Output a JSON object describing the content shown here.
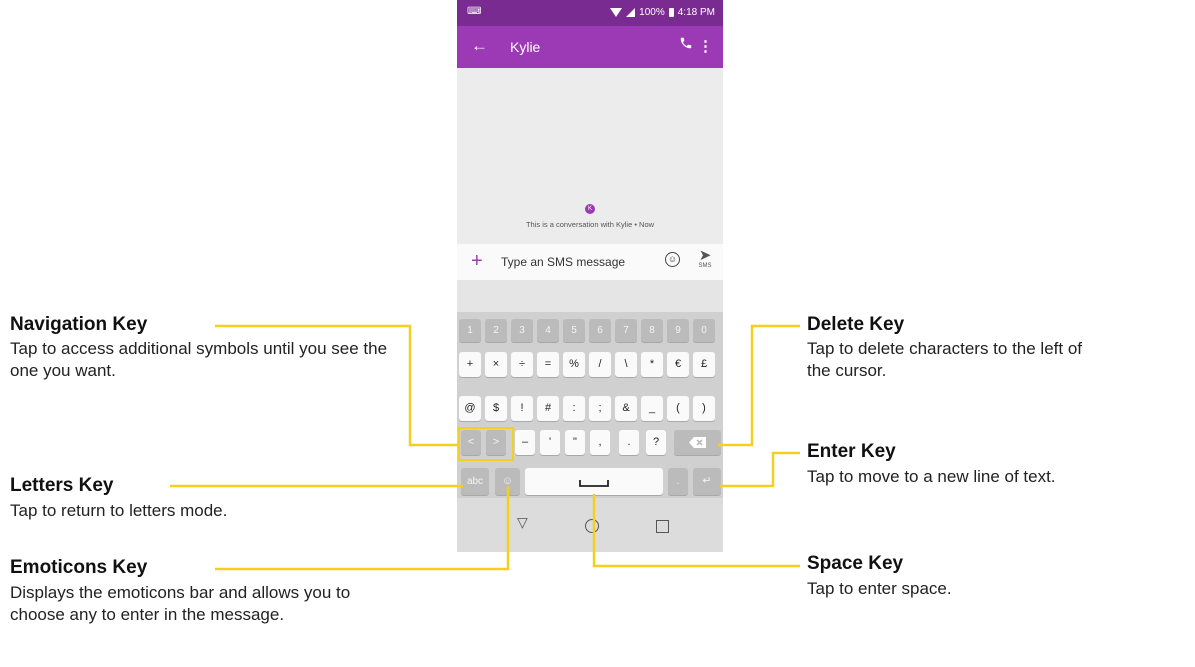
{
  "phone": {
    "status_bar": {
      "time": "4:18 PM",
      "battery": "100%"
    },
    "app_bar": {
      "back_icon": "arrow-left-icon",
      "title": "Kylie",
      "call_icon": "phone-icon",
      "more_icon": "more-vert-icon"
    },
    "conversation": {
      "avatar_letter": "K",
      "info": "This is a conversation with Kylie • Now"
    },
    "composer": {
      "placeholder": "Type an SMS message",
      "send_label": "SMS"
    },
    "keyboard": {
      "row1": [
        "1",
        "2",
        "3",
        "4",
        "5",
        "6",
        "7",
        "8",
        "9",
        "0"
      ],
      "row2": [
        "+",
        "×",
        "÷",
        "=",
        "%",
        "/",
        "\\",
        "*",
        "€",
        "£"
      ],
      "row3": [
        "@",
        "$",
        "!",
        "#",
        ":",
        ";",
        "&",
        "_",
        "(",
        ")"
      ],
      "row4": [
        "<",
        ">",
        "–",
        "'",
        "\"",
        ",",
        ".",
        "?"
      ],
      "abc_label": "abc",
      "period_label": "."
    }
  },
  "callouts": {
    "navigation": {
      "title": "Navigation Key",
      "desc": "Tap to access additional symbols until you see the one you want."
    },
    "letters": {
      "title": "Letters Key",
      "desc": "Tap to return to letters mode."
    },
    "emoticons": {
      "title": "Emoticons Key",
      "desc": "Displays the emoticons bar and allows you to choose any to enter in the message."
    },
    "delete": {
      "title": "Delete Key",
      "desc": "Tap to delete characters to the left of the cursor."
    },
    "enter": {
      "title": "Enter Key",
      "desc": "Tap to move to a new line of text."
    },
    "space": {
      "title": "Space Key",
      "desc": "Tap to enter space."
    }
  },
  "colors": {
    "accent": "#9c3ab5",
    "status_bar": "#7a2b91",
    "callout_line": "#f3d020"
  }
}
